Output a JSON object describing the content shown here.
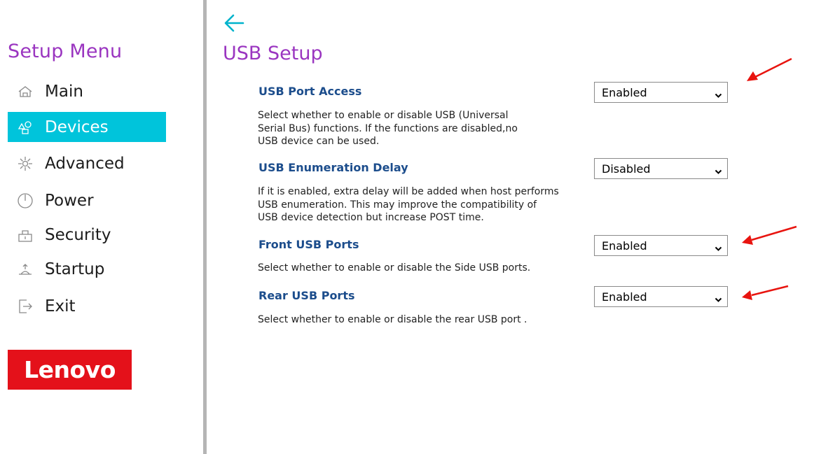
{
  "sidebar": {
    "title": "Setup Menu",
    "items": [
      {
        "label": "Main",
        "icon": "home-icon"
      },
      {
        "label": "Devices",
        "icon": "devices-icon",
        "active": true
      },
      {
        "label": "Advanced",
        "icon": "advanced-icon"
      },
      {
        "label": "Power",
        "icon": "power-icon"
      },
      {
        "label": "Security",
        "icon": "security-icon"
      },
      {
        "label": "Startup",
        "icon": "startup-icon"
      },
      {
        "label": "Exit",
        "icon": "exit-icon"
      }
    ],
    "logo_text": "Lenovo"
  },
  "main": {
    "title": "USB Setup",
    "settings": [
      {
        "label": "USB Port Access",
        "value": "Enabled",
        "desc_lines": [
          "Select whether to enable or disable USB (Universal",
          "Serial Bus) functions. If the functions are disabled,no",
          "USB device can be used."
        ]
      },
      {
        "label": "USB Enumeration Delay",
        "value": "Disabled",
        "desc_lines": [
          "If it is enabled, extra delay will be added when host performs",
          "USB enumeration. This may improve the compatibility of",
          "USB device detection but increase POST time."
        ]
      },
      {
        "label": "Front USB Ports",
        "value": "Enabled",
        "desc_lines": [
          "Select whether to enable or disable the Side USB ports."
        ]
      },
      {
        "label": "Rear USB Ports",
        "value": "Enabled",
        "desc_lines": [
          "Select whether to enable or disable the rear USB port ."
        ]
      }
    ]
  },
  "colors": {
    "accent_purple": "#9a35c0",
    "active_cyan": "#00c4db",
    "label_blue": "#1c4d8c",
    "lenovo_red": "#e4111a",
    "annotation_red": "#e8140f"
  }
}
